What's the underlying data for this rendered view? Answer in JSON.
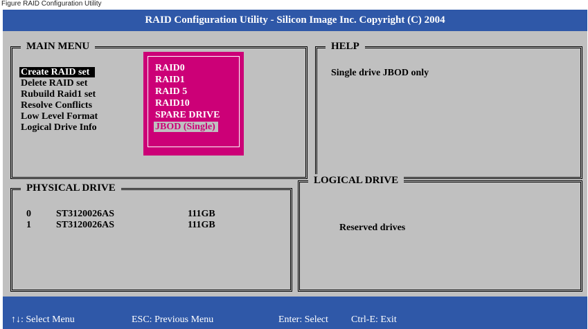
{
  "caption": "Figure RAID Configuration Utility",
  "title": "RAID Configuration Utility - Silicon Image Inc. Copyright (C) 2004",
  "main_menu": {
    "title": "MAIN MENU",
    "items": [
      {
        "label": "Create RAID set",
        "selected": true
      },
      {
        "label": "Delete RAID set"
      },
      {
        "label": "Rubuild Raid1 set"
      },
      {
        "label": "Resolve Conflicts"
      },
      {
        "label": "Low Level Format"
      },
      {
        "label": "Logical Drive Info"
      }
    ]
  },
  "raid_popup": {
    "items": [
      {
        "label": "RAID0"
      },
      {
        "label": "RAID1"
      },
      {
        "label": "RAID 5"
      },
      {
        "label": "RAID10"
      },
      {
        "label": "SPARE DRIVE"
      },
      {
        "label": "JBOD (Single)",
        "selected": true
      }
    ]
  },
  "help": {
    "title": "HELP",
    "text": "Single drive JBOD only"
  },
  "physical_drive": {
    "title": "PHYSICAL DRIVE",
    "rows": [
      {
        "index": "0",
        "model": "ST3120026AS",
        "size": "111GB"
      },
      {
        "index": "1",
        "model": "ST3120026AS",
        "size": "111GB"
      }
    ]
  },
  "logical_drive": {
    "title": "LOGICAL DRIVE",
    "text": "Reserved drives"
  },
  "footer": {
    "select_menu": "↑↓: Select Menu",
    "previous_menu": "ESC: Previous Menu",
    "enter_select": "Enter: Select",
    "exit": "Ctrl-E: Exit"
  },
  "colors": {
    "bar_blue": "#2f58a8",
    "screen_gray": "#c0c0c0",
    "popup_magenta": "#cc0077"
  }
}
